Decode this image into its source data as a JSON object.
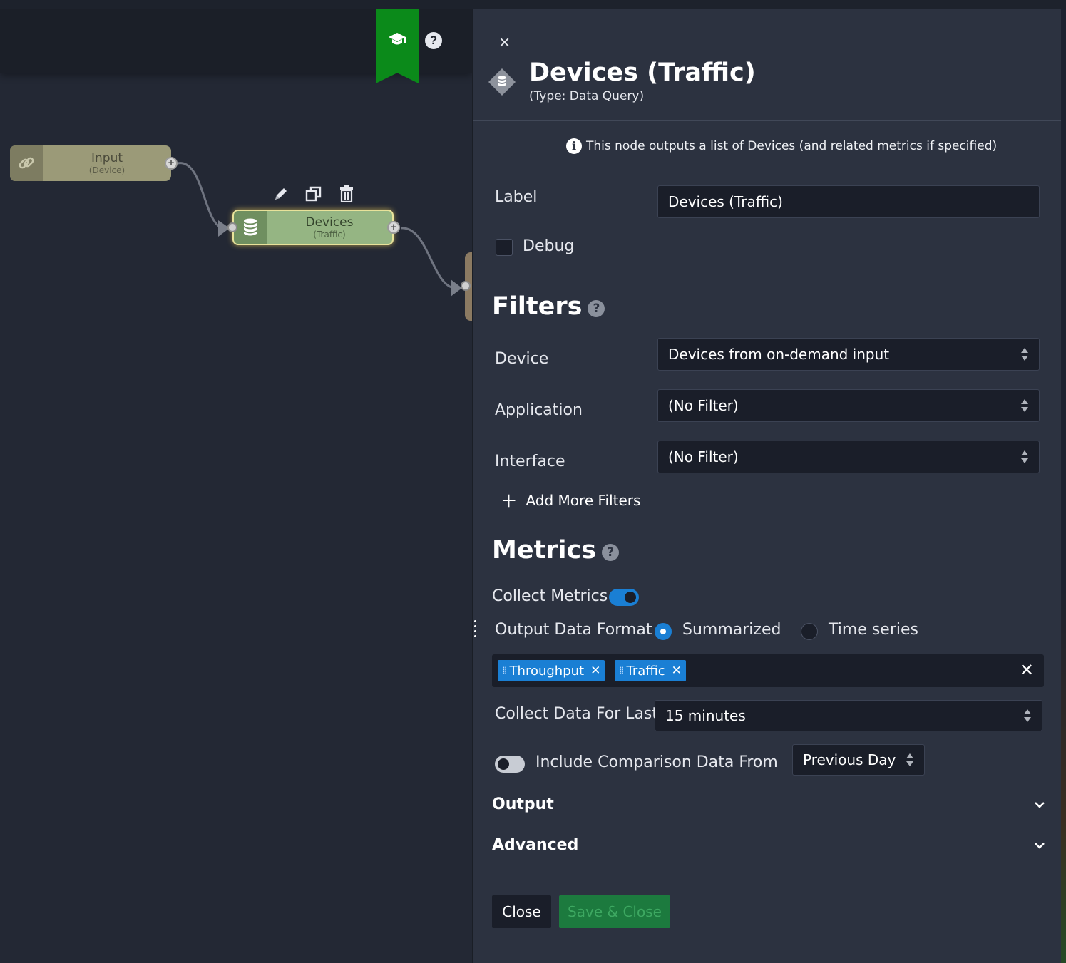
{
  "canvas": {
    "nodes": [
      {
        "title": "Input",
        "subtitle": "(Device)",
        "icon": "link-icon"
      },
      {
        "title": "Devices",
        "subtitle": "(Traffic)",
        "icon": "database-icon"
      }
    ],
    "node_actions": [
      "pencil-icon",
      "copy-icon",
      "trash-icon"
    ],
    "tutorial_icon": "graduation-cap-icon",
    "help_label": "?"
  },
  "panel": {
    "close_label": "×",
    "title": "Devices (Traffic)",
    "subtitle": "(Type: Data Query)",
    "info": "This node outputs a list of Devices (and related metrics if specified)",
    "label_field": {
      "label": "Label",
      "value": "Devices (Traffic)"
    },
    "debug": {
      "label": "Debug",
      "checked": false
    },
    "filters": {
      "heading": "Filters",
      "device": {
        "label": "Device",
        "value": "Devices from on-demand input"
      },
      "application": {
        "label": "Application",
        "value": "(No Filter)"
      },
      "interface": {
        "label": "Interface",
        "value": "(No Filter)"
      },
      "add_more": "Add More Filters"
    },
    "metrics": {
      "heading": "Metrics",
      "collect_label": "Collect Metrics",
      "collect_on": true,
      "format_label": "Output Data Format",
      "format_options": [
        "Summarized",
        "Time series"
      ],
      "format_selected": "Summarized",
      "tags": [
        "Throughput",
        "Traffic"
      ],
      "collect_for_label": "Collect Data For Last",
      "collect_for_value": "15 minutes",
      "comparison_label": "Include Comparison Data From",
      "comparison_on": false,
      "comparison_value": "Previous Day"
    },
    "sections": {
      "output": "Output",
      "advanced": "Advanced"
    },
    "buttons": {
      "close": "Close",
      "save": "Save & Close"
    }
  },
  "colors": {
    "accent": "#1a7fd4",
    "tutorial_green": "#0b8a1a",
    "save_green": "#1c7a3e"
  }
}
